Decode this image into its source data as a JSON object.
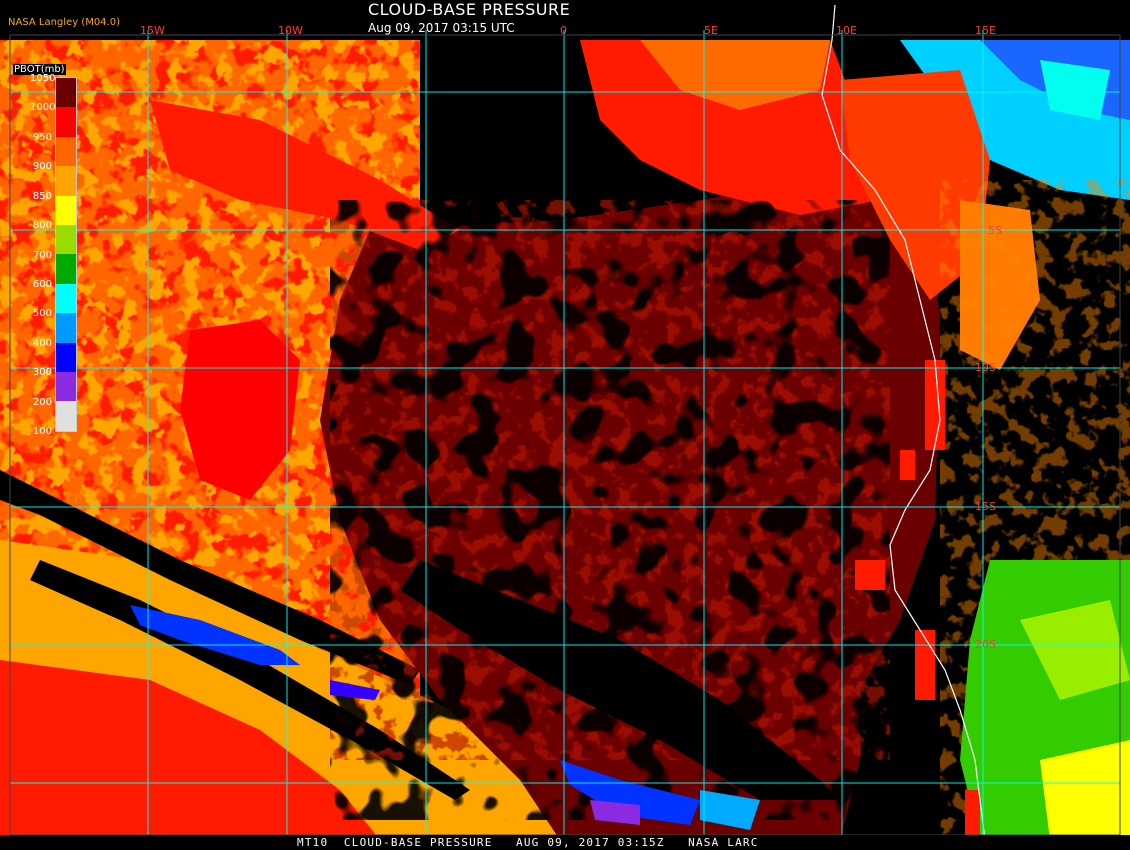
{
  "header": {
    "title": "CLOUD-BASE PRESSURE",
    "subtitle": "Aug 09, 2017 03:15 UTC",
    "producer": "NASA Langley (M04.0)"
  },
  "footer": {
    "text": "MT10  CLOUD-BASE PRESSURE   AUG 09, 2017 03:15Z   NASA LARC"
  },
  "legend": {
    "unit": "PBOT(mb)",
    "ticks": [
      "1050",
      "1000",
      "950",
      "900",
      "850",
      "800",
      "700",
      "600",
      "500",
      "400",
      "300",
      "200",
      "100"
    ],
    "colors": [
      "#6b0000",
      "#ff0000",
      "#ff6600",
      "#ffa500",
      "#ffff00",
      "#99dd00",
      "#00aa00",
      "#00ffff",
      "#0099ff",
      "#0000ff",
      "#8a2be2",
      "#e0e0e0"
    ]
  },
  "grid": {
    "lon_labels": [
      "15W",
      "10W",
      "0",
      "5E",
      "10E",
      "15E"
    ],
    "lat_labels": [
      "5S",
      "10S",
      "15S",
      "20S"
    ],
    "line_color": "#00ffff"
  },
  "palette": {
    "deep_red": "#6b0000",
    "red": "#ff0000",
    "orange": "#ff6600",
    "amber": "#ffa500",
    "yellow": "#ffff00",
    "green": "#33cc00",
    "cyan": "#00ffff",
    "blue": "#0033ff",
    "violet": "#8a2be2"
  }
}
